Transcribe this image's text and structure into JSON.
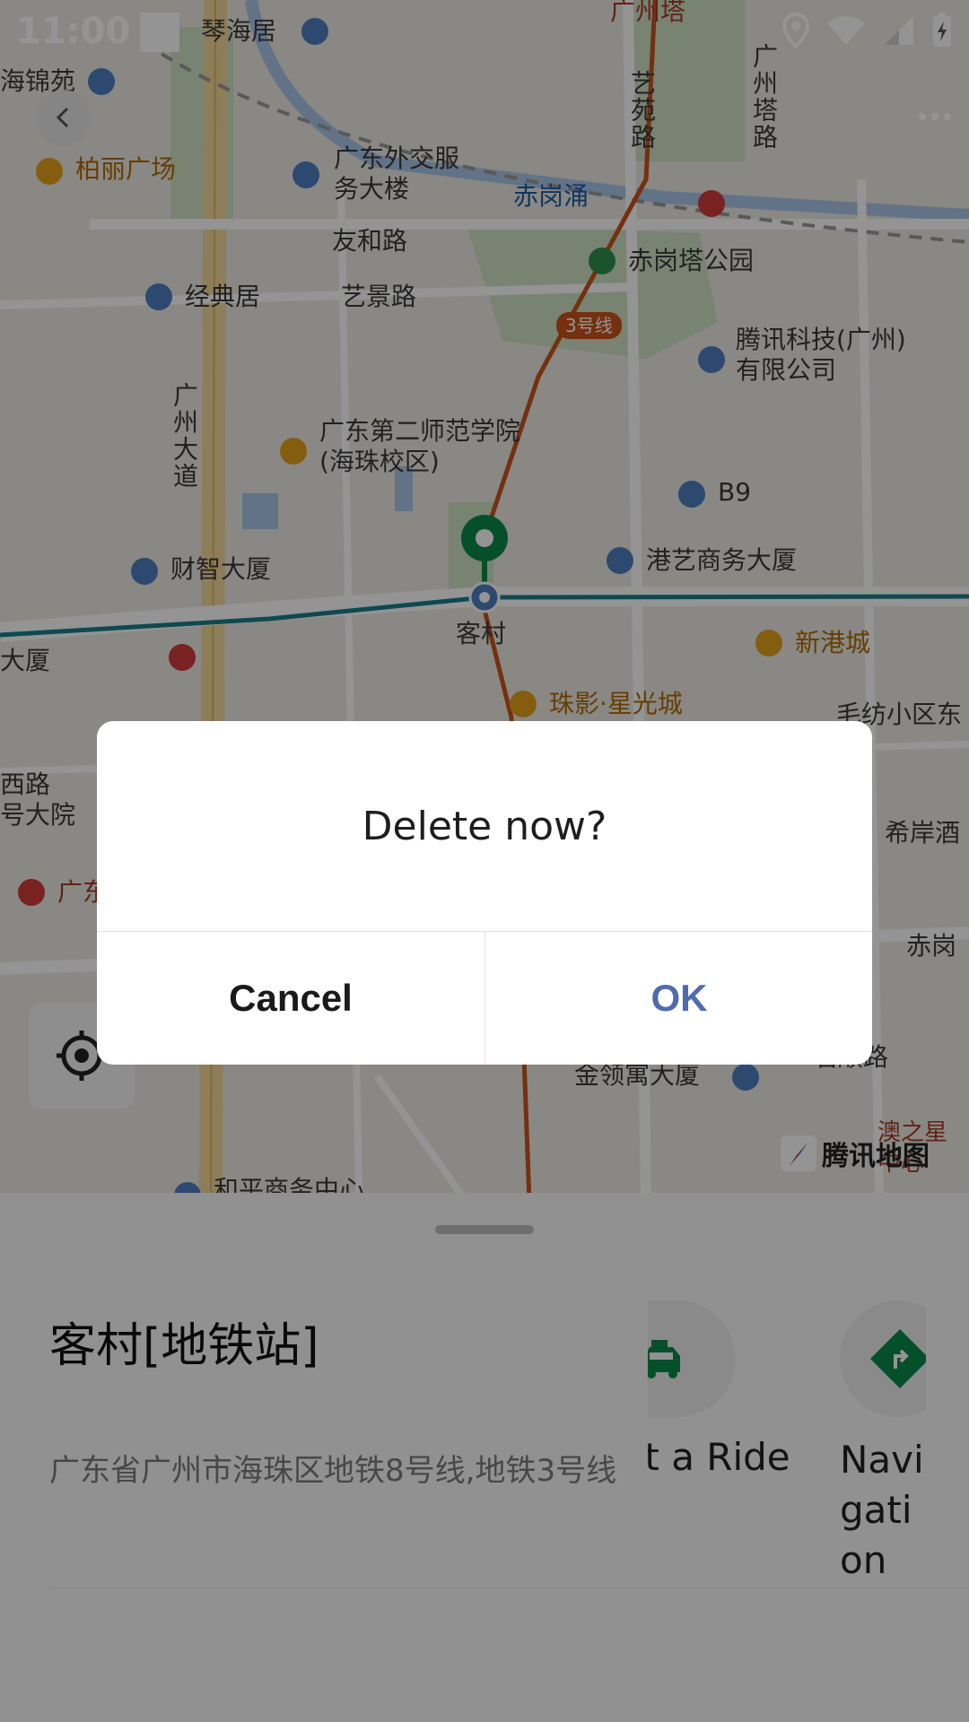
{
  "status_bar": {
    "time": "11:00",
    "icons": [
      "location-icon",
      "wifi-icon",
      "signal-icon",
      "battery-charging-icon"
    ]
  },
  "map": {
    "labels": {
      "guangzhou_tower": "广州塔",
      "qinhaiju": "琴海居",
      "haijinyuan": "海锦苑",
      "yiyuan_road": "艺苑路",
      "guangzhou_tower_road": "广州塔路",
      "bolihuangchang": "柏丽广场",
      "waijiao_building": "广东外交服务大楼",
      "chigangchong": "赤岗涌",
      "youhe_road": "友和路",
      "chigangta_park": "赤岗塔公园",
      "jingdianju": "经典居",
      "yijing_road": "艺景路",
      "line3": "3号线",
      "tencent": "腾讯科技(广州)有限公司",
      "guangzhou_avenue": "广州大道",
      "normal_college": "广东第二师范学院(海珠校区)",
      "b9": "B9",
      "caizhi_building": "财智大厦",
      "gangyi_building": "港艺商务大厦",
      "kecun": "客村",
      "xingangcheng": "新港城",
      "dasha": "大厦",
      "zhuying": "珠影·星光城",
      "maofang": "毛纺小区东",
      "xilu": "西路",
      "hao_dayuan": "号大院",
      "xian_hotel": "希岸酒",
      "guang": "广东",
      "chigang": "赤岗",
      "jinlingyu": "金领寓大厦",
      "jinglaoxuan": "君顺路",
      "heping": "和平商务中心",
      "aozhixing": "澳之星中心",
      "tencent_map": "腾讯地图"
    }
  },
  "sheet": {
    "place_name": "客村[地铁站]",
    "address": "广东省广州市海珠区地铁8号线,地铁3号线",
    "actions": [
      {
        "label": "Get a Ride",
        "icon": "taxi-icon"
      },
      {
        "label": "Navigation",
        "icon": "navigation-icon"
      }
    ]
  },
  "dialog": {
    "message": "Delete now?",
    "cancel": "Cancel",
    "ok": "OK"
  },
  "colors": {
    "ok_button": "#4f6bb0",
    "marker": "#0a8a4a",
    "metro_line3": "#c9541a",
    "metro_line8": "#1b7f8a"
  }
}
